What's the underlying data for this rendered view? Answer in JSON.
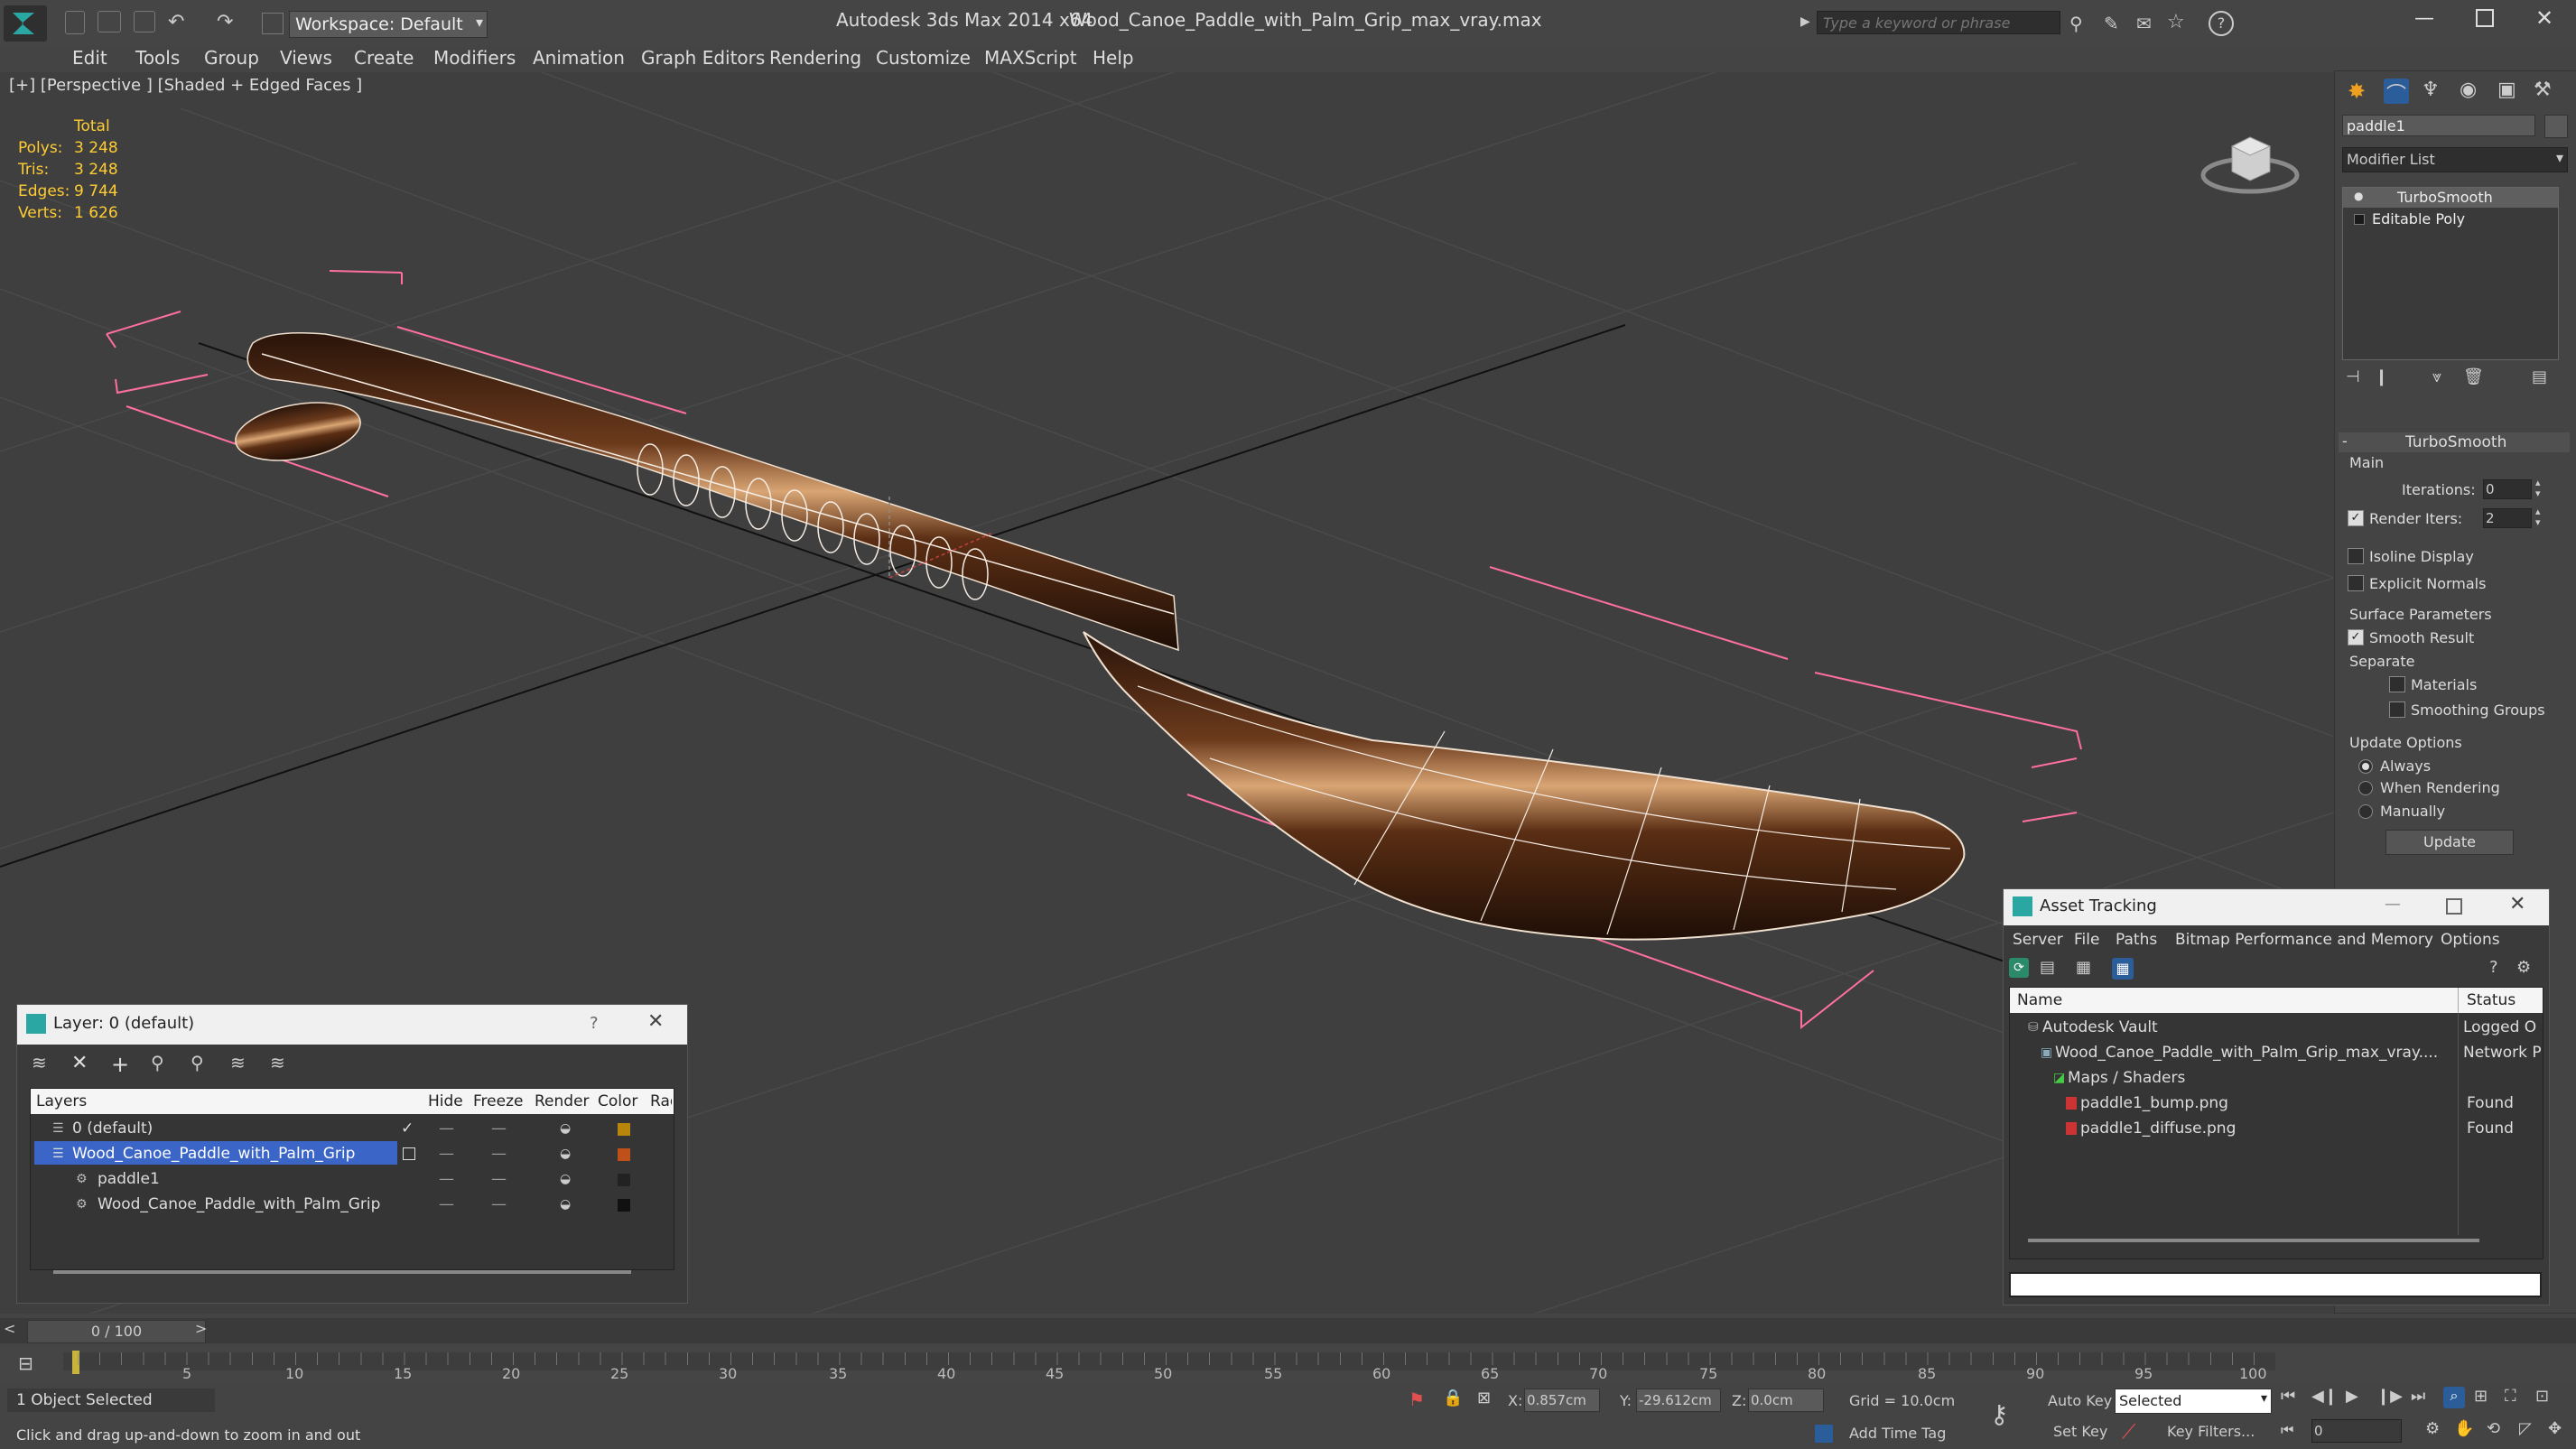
{
  "titlebar": {
    "workspace_label": "Workspace: Default",
    "app_title": "Autodesk 3ds Max  2014 x64",
    "file_title": "Wood_Canoe_Paddle_with_Palm_Grip_max_vray.max",
    "search_placeholder": "Type a keyword or phrase"
  },
  "menu": [
    "Edit",
    "Tools",
    "Group",
    "Views",
    "Create",
    "Modifiers",
    "Animation",
    "Graph Editors",
    "Rendering",
    "Customize",
    "MAXScript",
    "Help"
  ],
  "viewport": {
    "label": "[+] [Perspective ] [Shaded + Edged Faces ]",
    "stats": {
      "total_label": "Total",
      "rows": [
        {
          "label": "Polys:",
          "value": "3 248"
        },
        {
          "label": "Tris:",
          "value": "3 248"
        },
        {
          "label": "Edges:",
          "value": "9 744"
        },
        {
          "label": "Verts:",
          "value": "1 626"
        }
      ]
    }
  },
  "command_panel": {
    "object_name": "paddle1",
    "modifier_list_label": "Modifier List",
    "stack": [
      "TurboSmooth",
      "Editable Poly"
    ],
    "rollout_title": "TurboSmooth",
    "main_label": "Main",
    "iterations_label": "Iterations:",
    "iterations_value": "0",
    "render_iters_label": "Render Iters:",
    "render_iters_value": "2",
    "isoline_label": "Isoline Display",
    "explicit_normals_label": "Explicit Normals",
    "surface_params_label": "Surface Parameters",
    "smooth_result_label": "Smooth Result",
    "separate_label": "Separate",
    "materials_label": "Materials",
    "smoothing_groups_label": "Smoothing Groups",
    "update_options_label": "Update Options",
    "always_label": "Always",
    "when_rendering_label": "When Rendering",
    "manually_label": "Manually",
    "update_button": "Update"
  },
  "layer_window": {
    "title": "Layer: 0 (default)",
    "help": "?",
    "columns": [
      "Layers",
      "Hide",
      "Freeze",
      "Render",
      "Color",
      "Rad"
    ],
    "rows": [
      {
        "name": "0 (default)",
        "color": "#b8860b",
        "selected": false,
        "indent": 0
      },
      {
        "name": "Wood_Canoe_Paddle_with_Palm_Grip",
        "color": "#c0501a",
        "selected": true,
        "indent": 0
      },
      {
        "name": "paddle1",
        "color": "#222222",
        "selected": false,
        "indent": 1
      },
      {
        "name": "Wood_Canoe_Paddle_with_Palm_Grip",
        "color": "#111111",
        "selected": false,
        "indent": 1
      }
    ]
  },
  "asset_window": {
    "title": "Asset Tracking",
    "menu": [
      "Server",
      "File",
      "Paths",
      "Bitmap Performance and Memory",
      "Options"
    ],
    "col_name": "Name",
    "col_status": "Status",
    "rows": [
      {
        "name": "Autodesk Vault",
        "status": "Logged O",
        "indent": 1
      },
      {
        "name": "Wood_Canoe_Paddle_with_Palm_Grip_max_vray....",
        "status": "Network P",
        "indent": 2
      },
      {
        "name": "Maps / Shaders",
        "status": "",
        "indent": 3
      },
      {
        "name": "paddle1_bump.png",
        "status": "Found",
        "indent": 4
      },
      {
        "name": "paddle1_diffuse.png",
        "status": "Found",
        "indent": 4
      }
    ]
  },
  "timeline": {
    "frame_label": "0 / 100",
    "ticks": [
      "5",
      "10",
      "15",
      "20",
      "25",
      "30",
      "35",
      "40",
      "45",
      "50",
      "55",
      "60",
      "65",
      "70",
      "75",
      "80",
      "85",
      "90",
      "95",
      "100"
    ]
  },
  "status": {
    "selected": "1 Object Selected",
    "prompt": "Click and drag up-and-down to zoom in and out",
    "x_label": "X:",
    "x_value": "0.857cm",
    "y_label": "Y:",
    "y_value": "-29.612cm",
    "z_label": "Z:",
    "z_value": "0.0cm",
    "grid": "Grid = 10.0cm",
    "add_time_tag": "Add Time Tag",
    "auto_key": "Auto Key",
    "set_key": "Set Key",
    "selected_dropdown": "Selected",
    "key_filters": "Key Filters...",
    "frame_value": "0"
  }
}
